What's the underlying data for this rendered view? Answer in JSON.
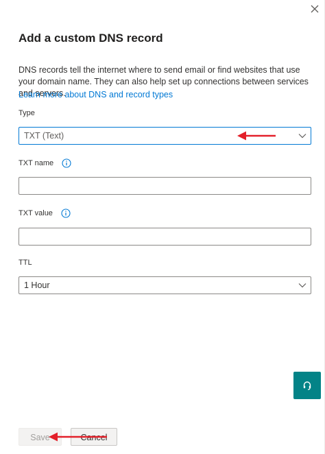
{
  "dialog": {
    "title": "Add a custom DNS record",
    "description": "DNS records tell the internet where to send email or find websites that use your domain name. They can also help set up connections between services and servers.",
    "learn_more_link": "Learn more about DNS and record types"
  },
  "form": {
    "type": {
      "label": "Type",
      "selected_value": "TXT (Text)"
    },
    "txt_name": {
      "label": "TXT name",
      "value": ""
    },
    "txt_value": {
      "label": "TXT value",
      "value": ""
    },
    "ttl": {
      "label": "TTL",
      "selected_value": "1 Hour"
    }
  },
  "footer": {
    "save_label": "Save",
    "cancel_label": "Cancel"
  },
  "icons": {
    "close": "close-icon",
    "info": "info-icon",
    "chevron": "chevron-down-icon",
    "help": "headset-icon"
  },
  "colors": {
    "accent": "#0078d4",
    "help_button": "#038387",
    "annotation_arrow": "#e3202a"
  }
}
